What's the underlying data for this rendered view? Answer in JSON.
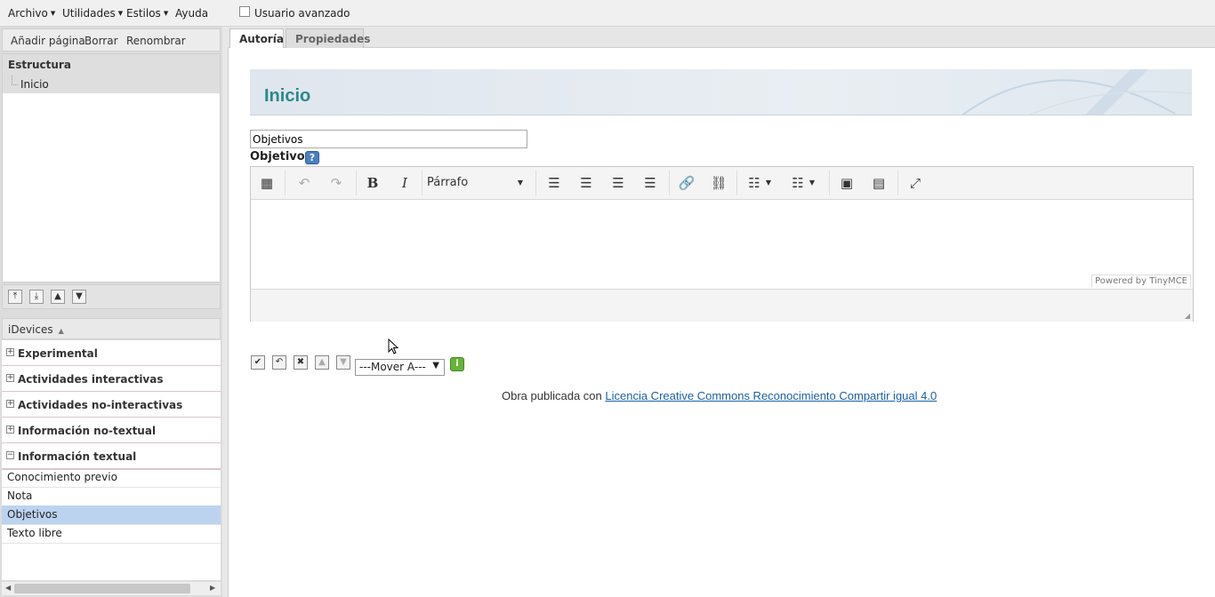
{
  "menubar": {
    "items": [
      {
        "label": "Archivo"
      },
      {
        "label": "Utilidades"
      },
      {
        "label": "Estilos"
      },
      {
        "label": "Ayuda"
      }
    ],
    "advanced_user": {
      "label": "Usuario avanzado",
      "checked": false
    }
  },
  "nav_toolbar": {
    "add_page": "Añadir página",
    "delete": "Borrar",
    "rename": "Renombrar"
  },
  "structure": {
    "title": "Estructura",
    "items": [
      {
        "label": "Inicio"
      }
    ]
  },
  "idevices": {
    "title": "iDevices",
    "categories": [
      {
        "label": "Experimental",
        "expanded": false
      },
      {
        "label": "Actividades interactivas",
        "expanded": false
      },
      {
        "label": "Actividades no-interactivas",
        "expanded": false
      },
      {
        "label": "Información no-textual",
        "expanded": false
      },
      {
        "label": "Información textual",
        "expanded": true
      }
    ],
    "items": [
      {
        "label": "Conocimiento previo"
      },
      {
        "label": "Nota"
      },
      {
        "label": "Objetivos"
      },
      {
        "label": "Texto libre"
      }
    ],
    "selected": "Objetivos"
  },
  "tabs": [
    {
      "label": "Autoría",
      "active": true
    },
    {
      "label": "Propiedades",
      "active": false
    }
  ],
  "page": {
    "title": "Inicio"
  },
  "idevice_editor": {
    "title_value": "Objetivos",
    "field_label": "Objetivos",
    "help_icon": "?",
    "format_select": "Párrafo",
    "powered_by": "Powered by TinyMCE"
  },
  "actions": {
    "move_select": "---Mover A---",
    "info_icon": "i"
  },
  "license": {
    "prefix": "Obra publicada con",
    "link_text": "Licencia Creative Commons Reconocimiento Compartir igual 4.0"
  },
  "colors": {
    "title_teal": "#2a8a8a",
    "link_blue": "#1a5fa8",
    "selected_bg": "#bcd3f0",
    "info_green": "#66b33a",
    "help_blue": "#4a7fc0"
  }
}
